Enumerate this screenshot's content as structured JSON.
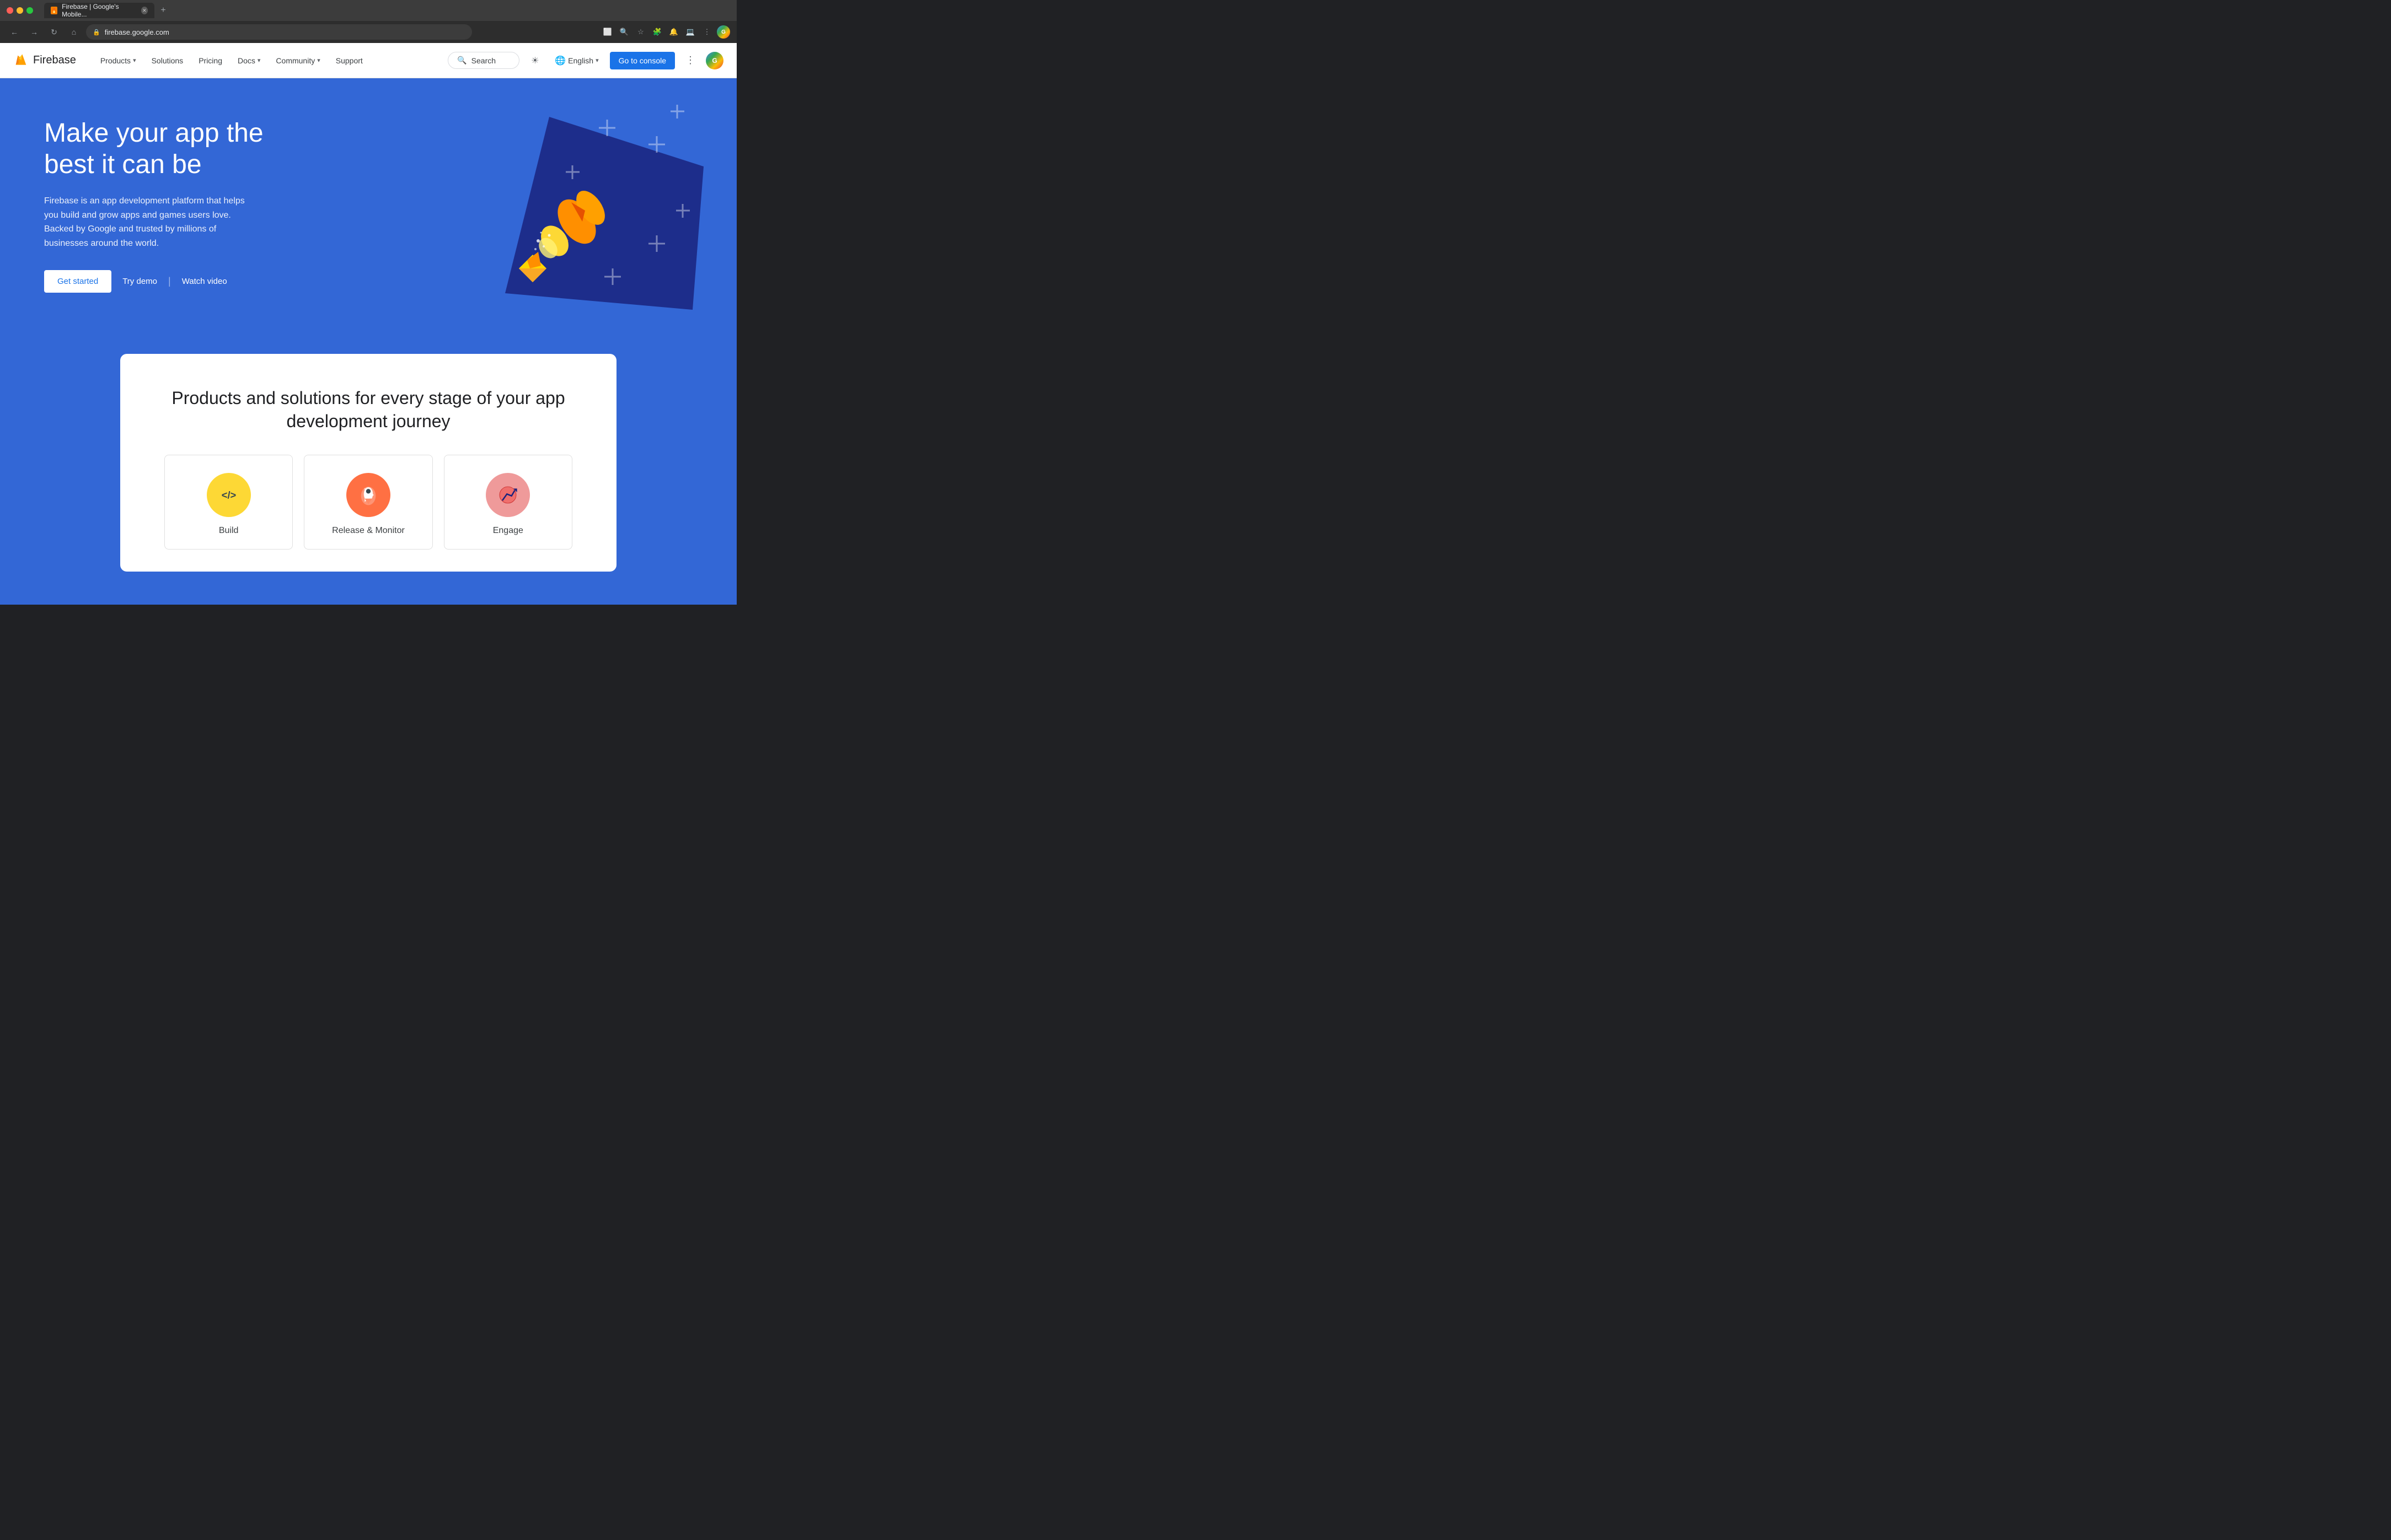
{
  "browser": {
    "tab_title": "Firebase | Google's Mobile...",
    "tab_favicon": "F",
    "url": "firebase.google.com",
    "new_tab_icon": "+",
    "back_icon": "←",
    "forward_icon": "→",
    "refresh_icon": "↻",
    "home_icon": "⌂"
  },
  "navbar": {
    "logo_text": "Firebase",
    "links": [
      {
        "label": "Products",
        "has_chevron": true
      },
      {
        "label": "Solutions",
        "has_chevron": false
      },
      {
        "label": "Pricing",
        "has_chevron": false
      },
      {
        "label": "Docs",
        "has_chevron": true
      },
      {
        "label": "Community",
        "has_chevron": true
      },
      {
        "label": "Support",
        "has_chevron": false
      }
    ],
    "search_placeholder": "Search",
    "language": "English",
    "go_to_console": "Go to console"
  },
  "hero": {
    "title": "Make your app the best it can be",
    "description": "Firebase is an app development platform that helps you build and grow apps and games users love. Backed by Google and trusted by millions of businesses around the world.",
    "get_started": "Get started",
    "try_demo": "Try demo",
    "watch_video": "Watch video"
  },
  "products_section": {
    "title": "Products and solutions for every stage of your app development journey",
    "items": [
      {
        "label": "Build",
        "icon_type": "build"
      },
      {
        "label": "Release & Monitor",
        "icon_type": "release"
      },
      {
        "label": "Engage",
        "icon_type": "engage"
      }
    ]
  }
}
